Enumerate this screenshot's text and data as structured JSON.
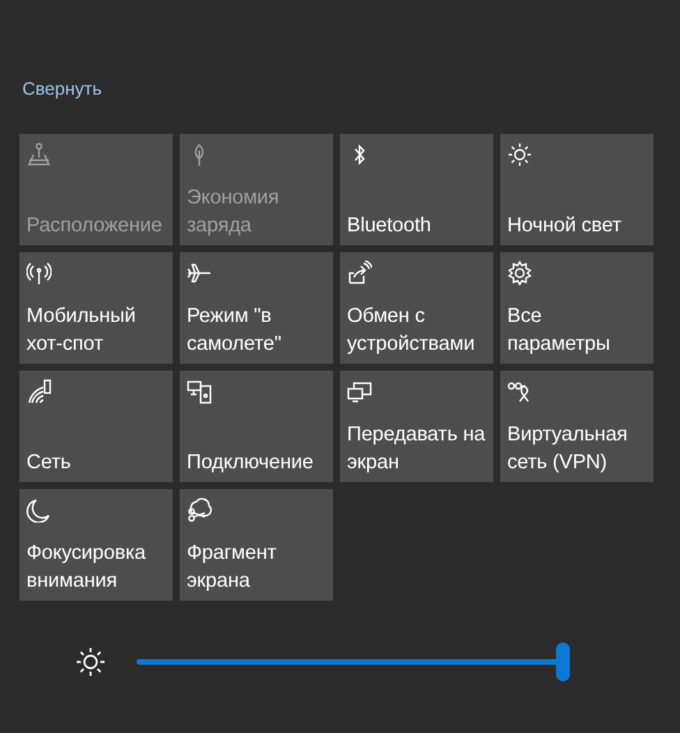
{
  "collapse_link": "Свернуть",
  "tiles": [
    {
      "label": "Расположение",
      "disabled": true
    },
    {
      "label": "Экономия заряда",
      "disabled": true
    },
    {
      "label": "Bluetooth",
      "disabled": false
    },
    {
      "label": "Ночной свет",
      "disabled": false
    },
    {
      "label": "Мобильный хот-спот",
      "disabled": false
    },
    {
      "label": "Режим \"в самолете\"",
      "disabled": false
    },
    {
      "label": "Обмен с устройствами",
      "disabled": false
    },
    {
      "label": "Все параметры",
      "disabled": false
    },
    {
      "label": "Сеть",
      "disabled": false
    },
    {
      "label": "Подключение",
      "disabled": false
    },
    {
      "label": "Передавать на экран",
      "disabled": false
    },
    {
      "label": "Виртуальная сеть (VPN)",
      "disabled": false
    },
    {
      "label": "Фокусировка внимания",
      "disabled": false
    },
    {
      "label": "Фрагмент экрана",
      "disabled": false
    }
  ],
  "brightness": {
    "level": 1.0
  }
}
